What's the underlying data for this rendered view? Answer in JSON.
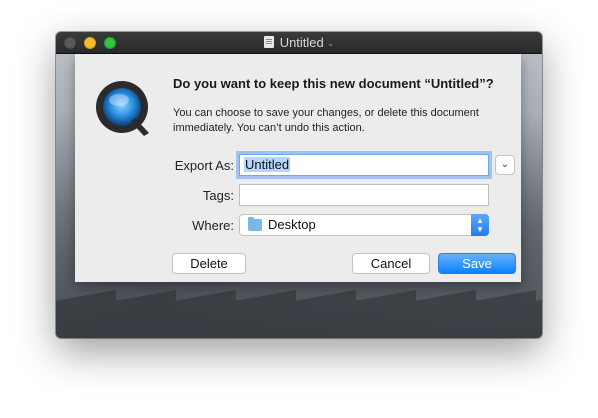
{
  "window": {
    "title": "Untitled"
  },
  "dialog": {
    "heading": "Do you want to keep this new document “Untitled”?",
    "message": "You can choose to save your changes, or delete this document immediately. You can’t undo this action.",
    "export_as_label": "Export As:",
    "export_as_value": "Untitled",
    "tags_label": "Tags:",
    "tags_value": "",
    "where_label": "Where:",
    "where_value": "Desktop",
    "delete_label": "Delete",
    "cancel_label": "Cancel",
    "save_label": "Save"
  },
  "colors": {
    "accent": "#0d81ff",
    "close": "#5a5a5c",
    "minimize": "#f5bd2e",
    "zoom": "#2ec740"
  },
  "icons": {
    "app": "quicktime-icon",
    "document": "document-icon",
    "folder": "folder-icon"
  }
}
